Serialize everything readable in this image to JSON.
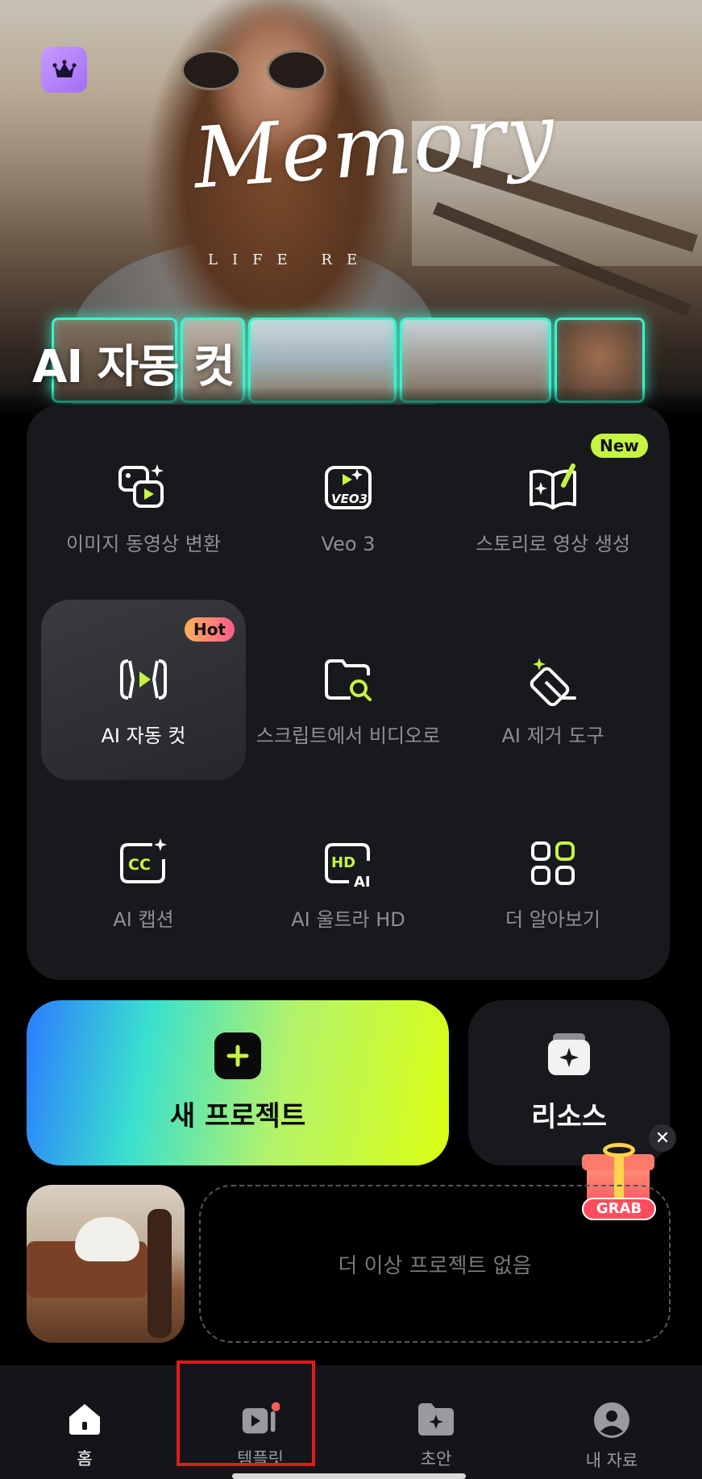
{
  "hero": {
    "title_art": "Memory",
    "subtitle_art": "LIFE RE",
    "label": "AI 자동 컷"
  },
  "tools": [
    {
      "id": "image-to-video",
      "label": "이미지 동영상 변환",
      "icon": "image-to-video-icon"
    },
    {
      "id": "veo3",
      "label": "Veo 3",
      "icon": "veo3-icon"
    },
    {
      "id": "story-video",
      "label": "스토리로 영상 생성",
      "icon": "story-book-icon",
      "badge": "New"
    },
    {
      "id": "ai-auto-cut",
      "label": "AI 자동 컷",
      "icon": "auto-cut-icon",
      "badge": "Hot",
      "selected": true
    },
    {
      "id": "script-to-video",
      "label": "스크립트에서 비디오로",
      "icon": "folder-search-icon"
    },
    {
      "id": "ai-remover",
      "label": "AI 제거 도구",
      "icon": "eraser-sparkle-icon"
    },
    {
      "id": "ai-caption",
      "label": "AI 캡션",
      "icon": "cc-caption-icon"
    },
    {
      "id": "ai-ultra-hd",
      "label": "AI 울트라 HD",
      "icon": "hd-ai-icon"
    },
    {
      "id": "more",
      "label": "더 알아보기",
      "icon": "grid-more-icon"
    }
  ],
  "actions": {
    "new_project": "새 프로젝트",
    "resources": "리소스"
  },
  "promo": {
    "close": "✕",
    "badge": "GRAB"
  },
  "projects": {
    "empty_text": "더 이상 프로젝트 없음"
  },
  "nav": [
    {
      "label": "홈",
      "icon": "home-icon",
      "active": true
    },
    {
      "label": "템플릿",
      "icon": "template-icon",
      "dot": true
    },
    {
      "label": "초안",
      "icon": "draft-folder-icon"
    },
    {
      "label": "내 자료",
      "icon": "profile-icon"
    }
  ],
  "colors": {
    "accent_green": "#c6f442",
    "panel": "#18191c",
    "highlight": "#e21b1b"
  }
}
